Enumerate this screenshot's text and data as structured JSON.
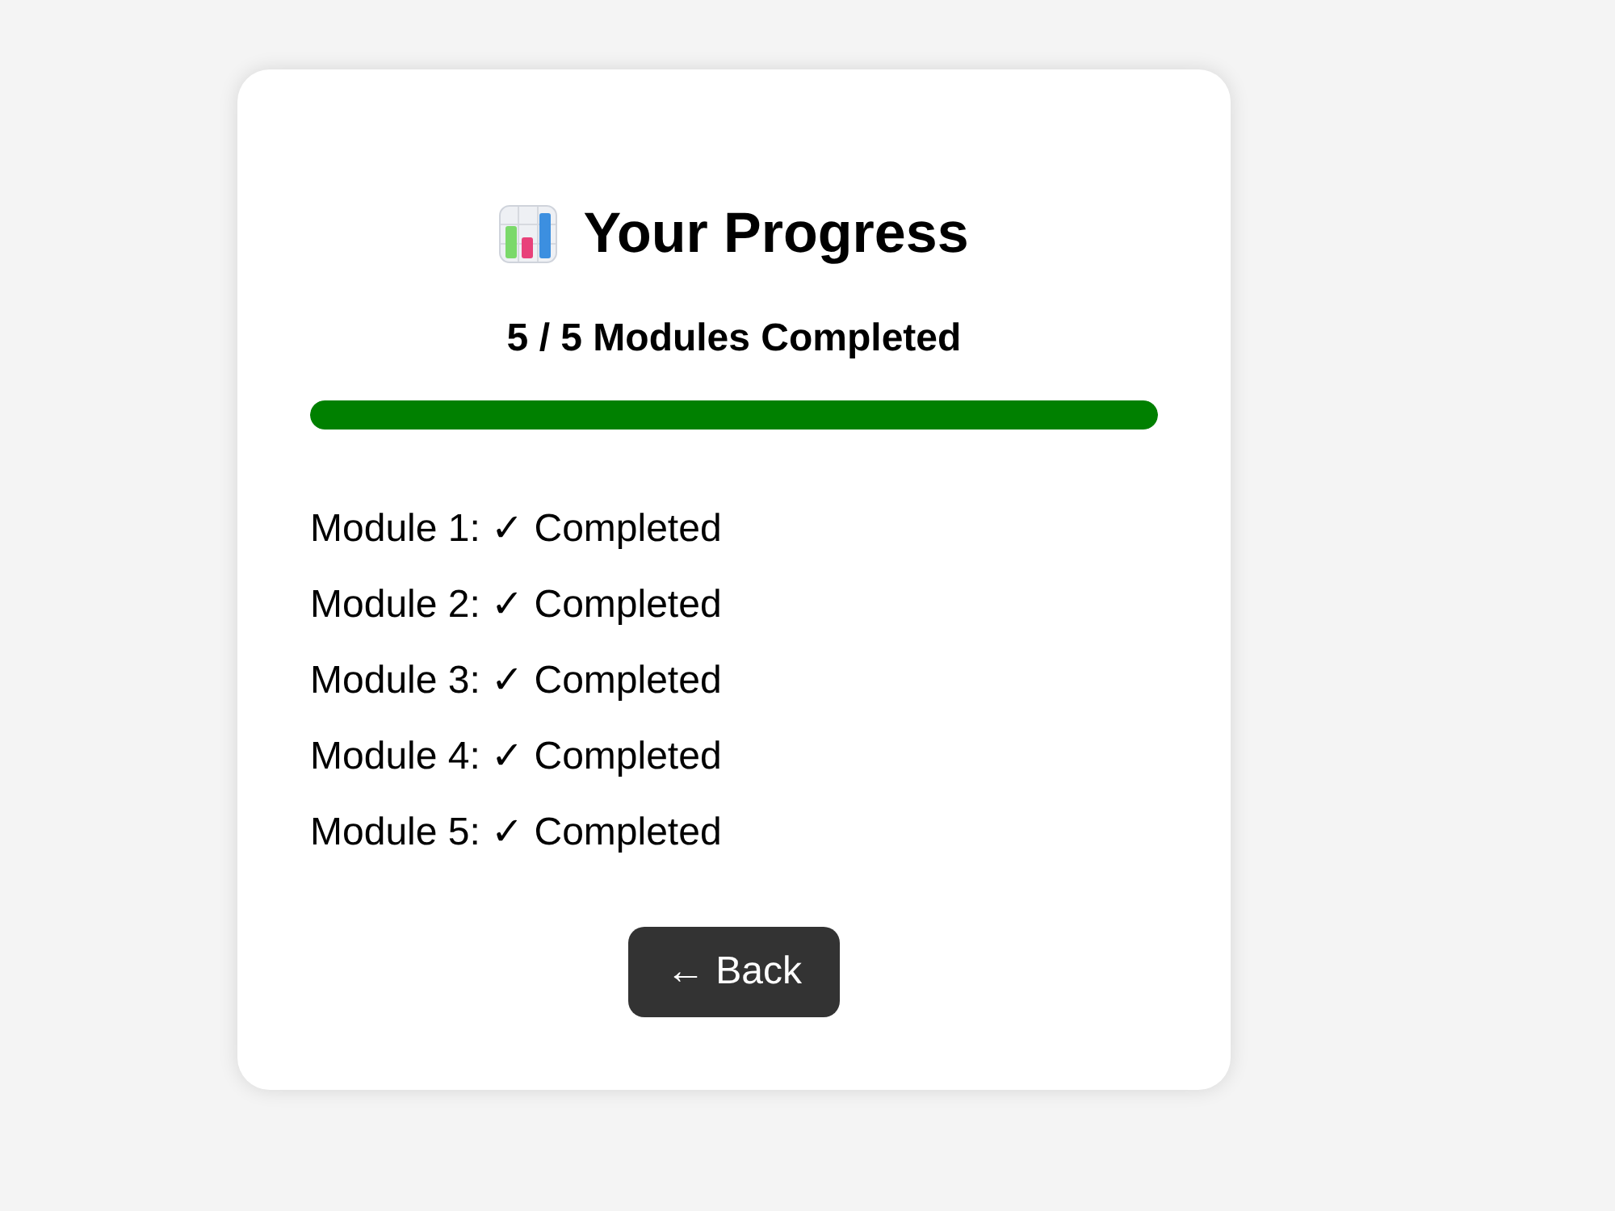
{
  "title": "Your Progress",
  "summary": "5 / 5 Modules Completed",
  "progress": {
    "level": 1
  },
  "modules": [
    {
      "text": "Module 1: ✓ Completed"
    },
    {
      "text": "Module 2: ✓ Completed"
    },
    {
      "text": "Module 3: ✓ Completed"
    },
    {
      "text": "Module 4: ✓ Completed"
    },
    {
      "text": "Module 5: ✓ Completed"
    }
  ],
  "back_button": {
    "label": "← Back"
  }
}
